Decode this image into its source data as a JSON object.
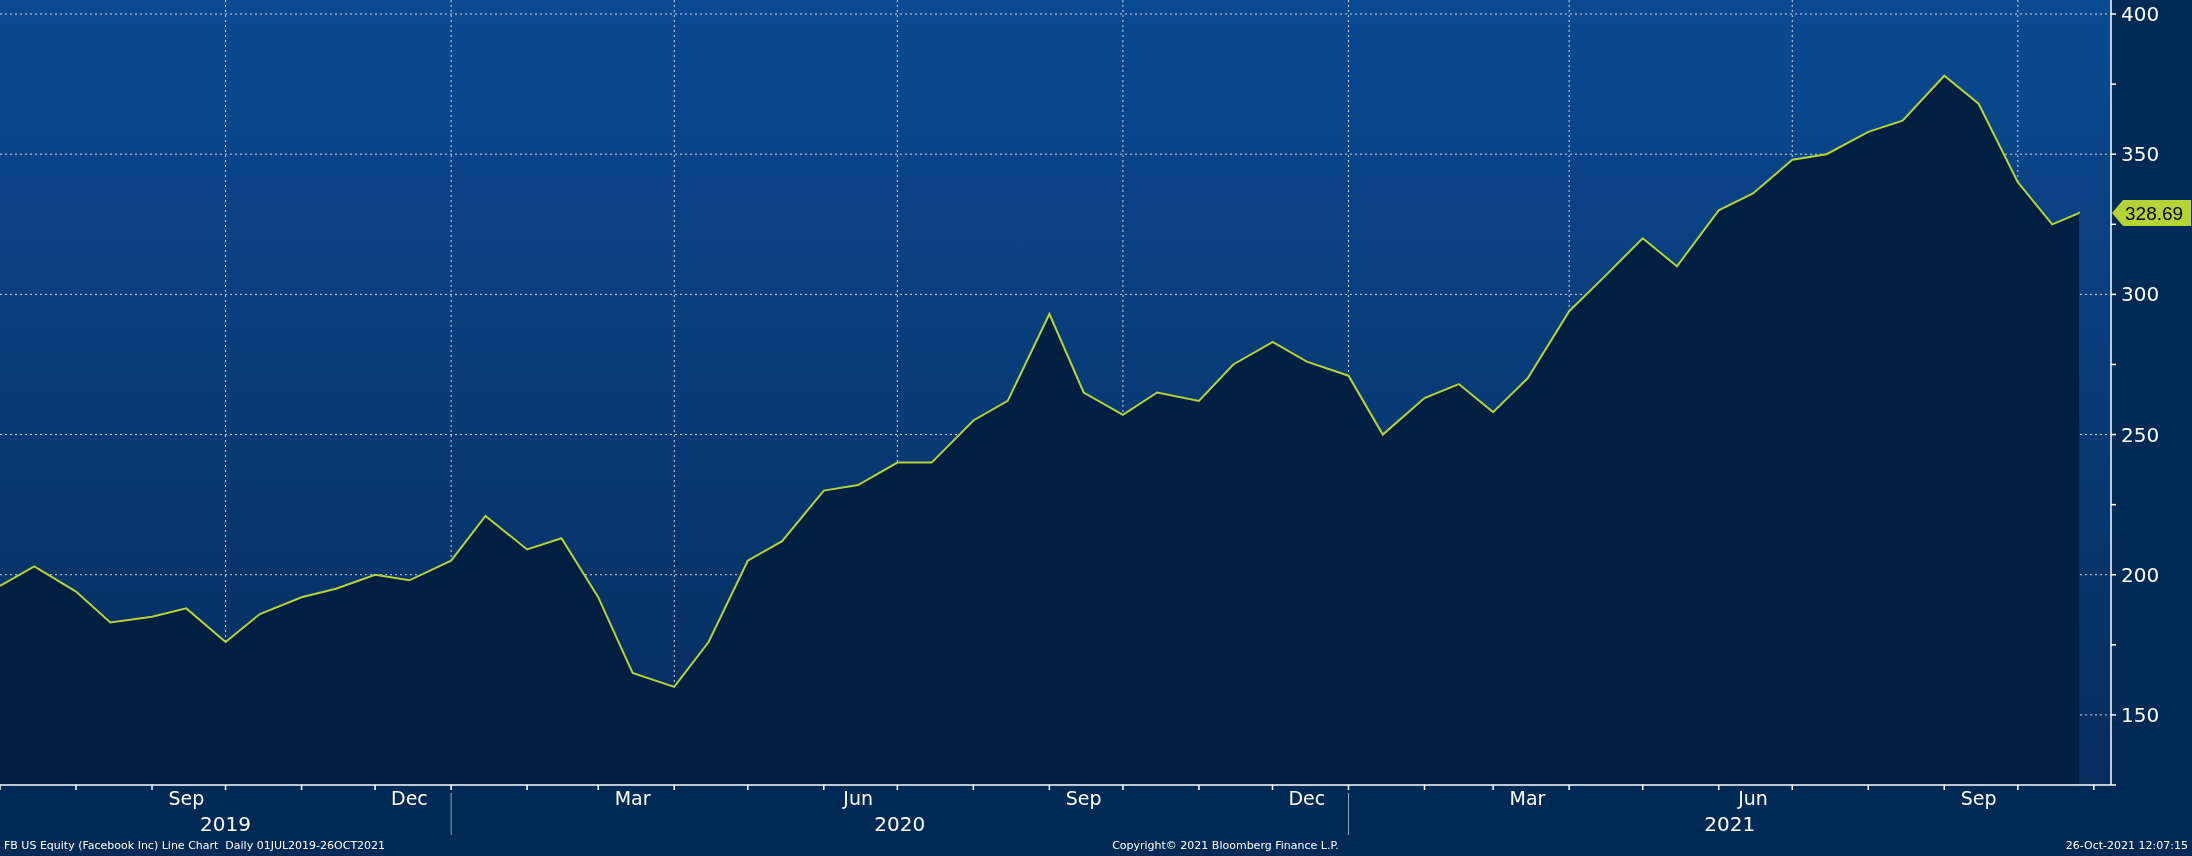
{
  "chart_data": {
    "type": "area",
    "grid": true,
    "x": [
      "2019-07-01",
      "2019-07-15",
      "2019-08-01",
      "2019-08-15",
      "2019-09-01",
      "2019-09-15",
      "2019-10-01",
      "2019-10-15",
      "2019-11-01",
      "2019-11-15",
      "2019-12-01",
      "2019-12-15",
      "2020-01-01",
      "2020-01-15",
      "2020-02-01",
      "2020-02-15",
      "2020-03-01",
      "2020-03-15",
      "2020-04-01",
      "2020-04-15",
      "2020-05-01",
      "2020-05-15",
      "2020-06-01",
      "2020-06-15",
      "2020-07-01",
      "2020-07-15",
      "2020-08-01",
      "2020-08-15",
      "2020-09-01",
      "2020-09-15",
      "2020-10-01",
      "2020-10-15",
      "2020-11-01",
      "2020-11-15",
      "2020-12-01",
      "2020-12-15",
      "2021-01-01",
      "2021-01-15",
      "2021-02-01",
      "2021-02-15",
      "2021-03-01",
      "2021-03-15",
      "2021-04-01",
      "2021-04-15",
      "2021-05-01",
      "2021-05-15",
      "2021-06-01",
      "2021-06-15",
      "2021-07-01",
      "2021-07-15",
      "2021-08-01",
      "2021-08-15",
      "2021-09-01",
      "2021-09-15",
      "2021-10-01",
      "2021-10-15",
      "2021-10-26"
    ],
    "series": [
      {
        "color": "#b5d334",
        "values": [
          196,
          203,
          194,
          183,
          185,
          188,
          176,
          186,
          192,
          195,
          200,
          198,
          205,
          221,
          209,
          213,
          192,
          165,
          160,
          176,
          205,
          212,
          230,
          232,
          240,
          240,
          255,
          262,
          293,
          265,
          257,
          265,
          262,
          275,
          283,
          276,
          271,
          250,
          263,
          268,
          258,
          270,
          294,
          306,
          320,
          310,
          330,
          336,
          348,
          350,
          358,
          362,
          378,
          368,
          340,
          325,
          329
        ]
      }
    ],
    "xlim": [
      "2019-07-01",
      "2021-11-08"
    ],
    "ylim": [
      125,
      405
    ],
    "yticks": [
      150,
      200,
      250,
      300,
      350,
      400
    ],
    "xticks": [
      {
        "value": "2019-09-15",
        "label": "Sep"
      },
      {
        "value": "2019-12-15",
        "label": "Dec"
      },
      {
        "value": "2020-03-15",
        "label": "Mar"
      },
      {
        "value": "2020-06-15",
        "label": "Jun"
      },
      {
        "value": "2020-09-15",
        "label": "Sep"
      },
      {
        "value": "2020-12-15",
        "label": "Dec"
      },
      {
        "value": "2021-03-15",
        "label": "Mar"
      },
      {
        "value": "2021-06-15",
        "label": "Jun"
      },
      {
        "value": "2021-09-15",
        "label": "Sep"
      }
    ]
  },
  "x_axis_years": [
    "2019",
    "2020",
    "2021"
  ],
  "price_tag": "328.69",
  "footer": {
    "description": "FB US Equity (Facebook Inc) Line Chart  Daily 01JUL2019-26OCT2021",
    "copyright": "Copyright© 2021 Bloomberg Finance L.P.",
    "timestamp": "26-Oct-2021 12:07:15"
  }
}
